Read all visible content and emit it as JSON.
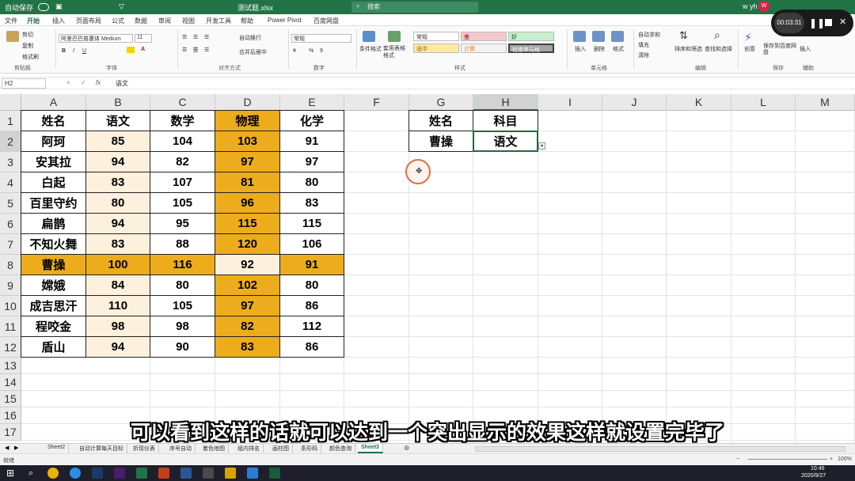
{
  "titlebar": {
    "autosave": "自动保存",
    "filename": "测试题.xlsx",
    "search_placeholder": "搜索",
    "user": "w yh",
    "avatar": "W"
  },
  "menu": [
    "文件",
    "开始",
    "插入",
    "页面布局",
    "公式",
    "数据",
    "审阅",
    "视图",
    "开发工具",
    "帮助",
    "Power Pivot",
    "百度网盘"
  ],
  "ribbon": {
    "paste_group": {
      "cut": "剪切",
      "copy": "复制",
      "format_painter": "格式刷",
      "label": "剪贴板"
    },
    "font_group": {
      "font_name": "阿里巴巴普惠体 Medium",
      "font_size": "11",
      "label": "字体"
    },
    "align_group": {
      "wrap": "自动换行",
      "merge": "合并后居中",
      "label": "对齐方式"
    },
    "number_group": {
      "format": "常规",
      "label": "数字"
    },
    "styles_group": {
      "conditional": "条件格式",
      "table": "套用表格格式",
      "label": "样式",
      "cells": [
        "常规",
        "差",
        "好",
        "适中",
        "计算",
        "检查单元格"
      ]
    },
    "cells_group": {
      "insert": "插入",
      "delete": "删除",
      "format": "格式",
      "label": "单元格"
    },
    "edit_group": {
      "autosum": "自动求和",
      "fill": "填充",
      "clear": "清除",
      "sort": "排序和筛选",
      "find": "查找和选择",
      "label": "编辑"
    },
    "ideas": "创意",
    "save_baidu": "保存到百度网盘",
    "save_label": "保存",
    "insert_label": "插入",
    "teacher_label": "辅助"
  },
  "recorder": {
    "time": "00:03:31"
  },
  "formula_bar": {
    "cell": "H2",
    "cancel": "×",
    "enter": "✓",
    "fx": "fx",
    "value": "语文"
  },
  "columns": [
    "A",
    "B",
    "C",
    "D",
    "E",
    "F",
    "G",
    "H",
    "I",
    "J",
    "K",
    "L",
    "M"
  ],
  "rows": [
    "1",
    "2",
    "3",
    "4",
    "5",
    "6",
    "7",
    "8",
    "9",
    "10",
    "11",
    "12",
    "13",
    "14",
    "15",
    "16",
    "17"
  ],
  "table": {
    "headers": [
      "姓名",
      "语文",
      "数学",
      "物理",
      "化学"
    ],
    "rows": [
      [
        "阿珂",
        "85",
        "104",
        "103",
        "91"
      ],
      [
        "安其拉",
        "94",
        "82",
        "97",
        "97"
      ],
      [
        "白起",
        "83",
        "107",
        "81",
        "80"
      ],
      [
        "百里守约",
        "80",
        "105",
        "96",
        "83"
      ],
      [
        "扁鹊",
        "94",
        "95",
        "115",
        "115"
      ],
      [
        "不知火舞",
        "83",
        "88",
        "120",
        "106"
      ],
      [
        "曹操",
        "100",
        "116",
        "92",
        "91"
      ],
      [
        "嫦娥",
        "84",
        "80",
        "102",
        "80"
      ],
      [
        "成吉思汗",
        "110",
        "105",
        "97",
        "86"
      ],
      [
        "程咬金",
        "98",
        "98",
        "82",
        "112"
      ],
      [
        "盾山",
        "94",
        "90",
        "83",
        "86"
      ]
    ]
  },
  "lookup": {
    "g1": "姓名",
    "h1": "科目",
    "g2": "曹操",
    "h2": "语文"
  },
  "sheets": [
    "Sheet2",
    "自动计算每天目标",
    "折现仪表",
    "序号自动",
    "着色地图",
    "组内排名",
    "画柱图",
    "条形码",
    "颜色查询",
    "Sheet3"
  ],
  "status": {
    "ready": "就绪",
    "zoom": "100%"
  },
  "clock": {
    "time": "10:46",
    "date": "2020/9/27"
  },
  "subtitle": "可以看到这样的话就可以达到一个突出显示的效果这样就设置完毕了",
  "colors": {
    "excel_green": "#217346",
    "highlight": "#ecac1c",
    "light": "#fdf0dc"
  }
}
